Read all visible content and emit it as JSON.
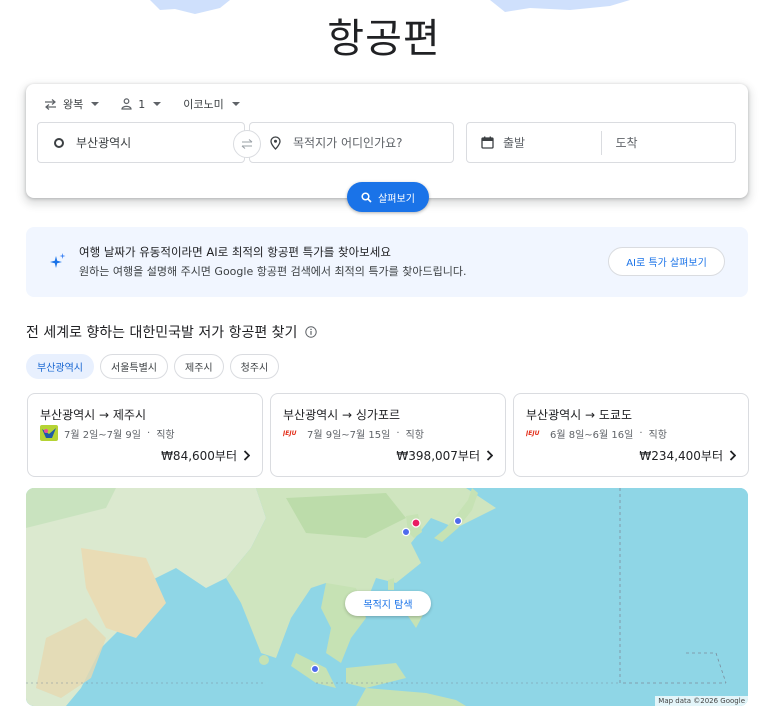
{
  "page": {
    "title": "항공편"
  },
  "search": {
    "trip_type": "왕복",
    "passengers": "1",
    "cabin_class": "이코노미",
    "origin": "부산광역시",
    "destination_placeholder": "목적지가 어디인가요?",
    "depart_placeholder": "출발",
    "return_placeholder": "도착",
    "explore_button": "살펴보기"
  },
  "ai_banner": {
    "title": "여행 날짜가 유동적이라면 AI로 최적의 항공편 특가를 찾아보세요",
    "subtitle": "원하는 여행을 설명해 주시면 Google 항공편 검색에서 최적의 특가를 찾아드립니다.",
    "button": "AI로 특가 살펴보기"
  },
  "deals": {
    "section_title": "전 세계로 향하는 대한민국발 저가 항공편 찾기",
    "chips": [
      {
        "label": "부산광역시",
        "active": true
      },
      {
        "label": "서울특별시",
        "active": false
      },
      {
        "label": "제주시",
        "active": false
      },
      {
        "label": "청주시",
        "active": false
      }
    ],
    "cards": [
      {
        "route": "부산광역시 → 제주시",
        "dates": "7월 2일~7월 9일",
        "stops": "직항",
        "price": "₩84,600부터"
      },
      {
        "route": "부산광역시 → 싱가포르",
        "dates": "7월 9일~7월 15일",
        "stops": "직항",
        "price": "₩398,007부터"
      },
      {
        "route": "부산광역시 → 도쿄도",
        "dates": "6월 8일~6월 16일",
        "stops": "직항",
        "price": "₩234,400부터"
      }
    ]
  },
  "map": {
    "explore_button": "목적지 탐색",
    "credit": "Map data ©2026 Google"
  },
  "colors": {
    "accent": "#1a73e8",
    "banner_bg": "#f1f6ff",
    "map_water": "#8fd6e6",
    "map_land": "#d9ead3",
    "pin_origin": "#e91e63",
    "pin_dest": "#4f6bed"
  },
  "icons": [
    "swap-arrows-icon",
    "person-icon",
    "origin-circle-icon",
    "location-pin-icon",
    "calendar-icon",
    "search-icon",
    "sparkle-icon",
    "info-icon",
    "chevron-right-icon"
  ]
}
